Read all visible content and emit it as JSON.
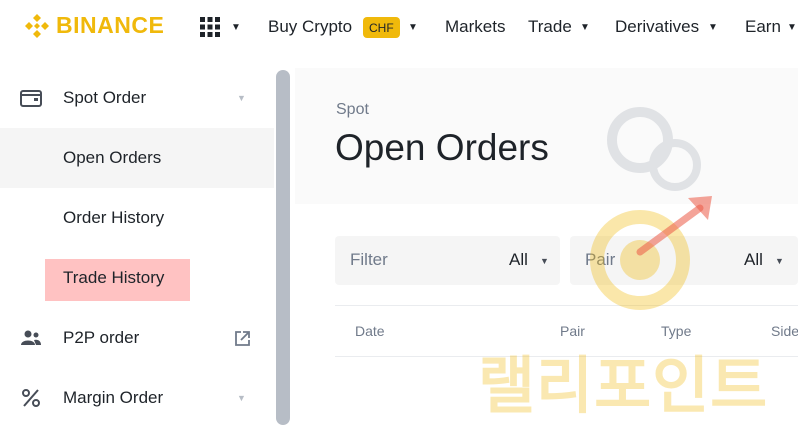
{
  "brand": {
    "name": "BINANCE",
    "color": "#F0B90B"
  },
  "nav": {
    "buy_crypto": "Buy Crypto",
    "currency_badge": "CHF",
    "markets": "Markets",
    "trade": "Trade",
    "derivatives": "Derivatives",
    "earn": "Earn"
  },
  "sidebar": {
    "items": [
      {
        "label": "Spot Order",
        "icon": "wallet-icon"
      },
      {
        "label": "Open Orders"
      },
      {
        "label": "Order History"
      },
      {
        "label": "Trade History"
      },
      {
        "label": "P2P order",
        "icon": "users-icon"
      },
      {
        "label": "Margin Order",
        "icon": "percent-icon"
      }
    ]
  },
  "main": {
    "breadcrumb": "Spot",
    "title": "Open Orders",
    "filters": [
      {
        "label": "Filter",
        "value": "All"
      },
      {
        "label": "Pair",
        "value": "All"
      }
    ],
    "table_headers": [
      "Date",
      "Pair",
      "Type",
      "Side"
    ]
  },
  "watermark": {
    "text": "랠리포인트"
  },
  "colors": {
    "accent": "#F0B90B",
    "highlight": "#ffc2c2",
    "muted": "#707a8a"
  }
}
